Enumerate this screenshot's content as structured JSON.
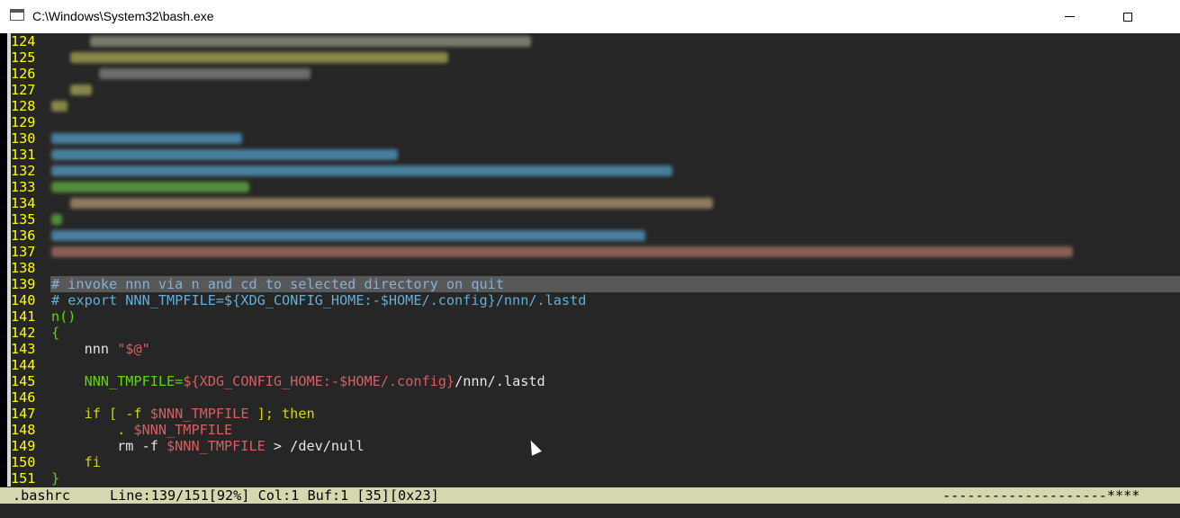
{
  "window": {
    "title": "C:\\Windows\\System32\\bash.exe",
    "min_icon": "minimize-icon",
    "max_icon": "maximize-icon",
    "close_icon": "close-icon"
  },
  "editor": {
    "blurred_lines": [
      "124",
      "125",
      "126",
      "127",
      "128",
      "129",
      "130",
      "131",
      "132",
      "133",
      "134",
      "135",
      "136",
      "137",
      "138"
    ],
    "lines": [
      {
        "n": "139",
        "text": "# invoke nnn via n and cd to selected directory on quit"
      },
      {
        "n": "140",
        "text": "# export NNN_TMPFILE=${XDG_CONFIG_HOME:-$HOME/.config}/nnn/.lastd"
      },
      {
        "n": "141",
        "text": "n()"
      },
      {
        "n": "142",
        "text": "{"
      },
      {
        "n": "143",
        "a": "    nnn ",
        "b": "\"$@\""
      },
      {
        "n": "144",
        "text": ""
      },
      {
        "n": "145",
        "a": "    NNN_TMPFILE=",
        "b": "${XDG_CONFIG_HOME:-",
        "c": "$HOME",
        "d": "/.config}",
        "e": "/nnn/.lastd"
      },
      {
        "n": "146",
        "text": ""
      },
      {
        "n": "147",
        "a": "    if [ -f ",
        "b": "$NNN_TMPFILE",
        "c": " ]; then"
      },
      {
        "n": "148",
        "a": "        . ",
        "b": "$NNN_TMPFILE"
      },
      {
        "n": "149",
        "a": "        rm -f ",
        "b": "$NNN_TMPFILE",
        "c": " > /dev/null"
      },
      {
        "n": "150",
        "a": "    fi"
      },
      {
        "n": "151",
        "text": "}"
      }
    ]
  },
  "status": {
    "file": ".bashrc",
    "position": "Line:139/151[92%] Col:1 Buf:1 [35][0x23]",
    "flags": "--------------------****"
  },
  "colors": {
    "background": "#262626",
    "line_number": "#ffff00",
    "comment": "#5fafd7",
    "string": "#d75f5f",
    "keyword": "#d7d700",
    "variable_name": "#5fd700",
    "status_bar": "#d7d7af"
  }
}
